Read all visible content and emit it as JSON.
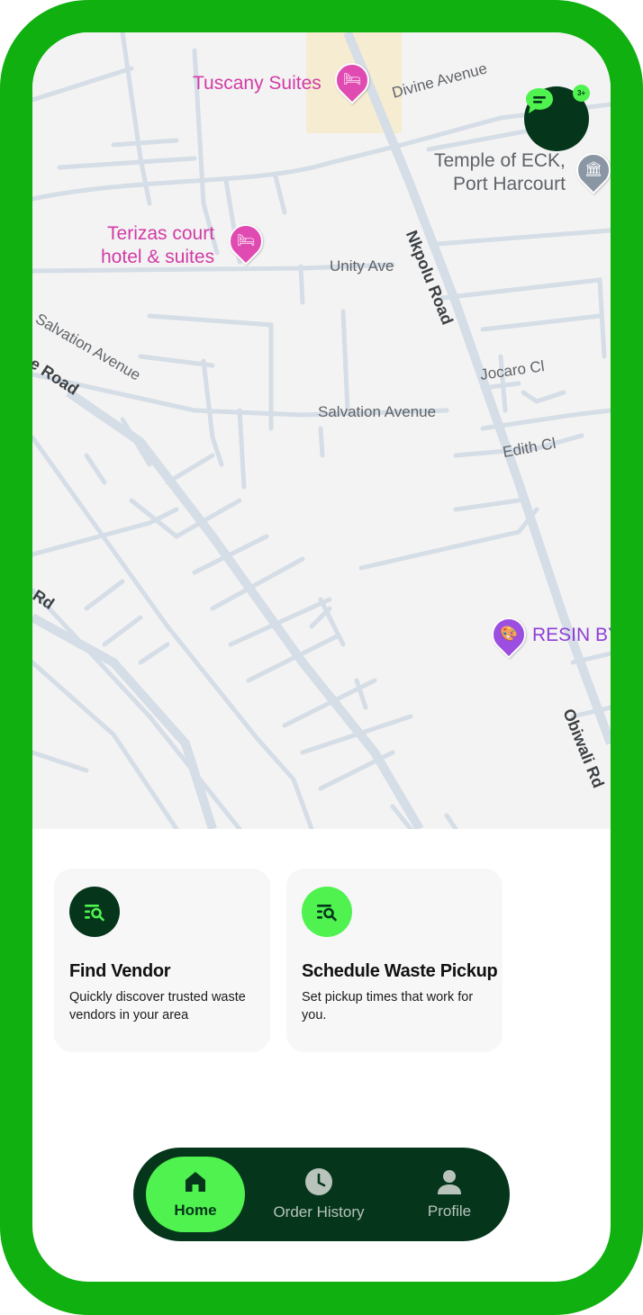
{
  "map": {
    "poi": {
      "tuscany": "Tuscany Suites",
      "terizas_line1": "Terizas court",
      "terizas_line2": "hotel & suites",
      "temple_line1": "Temple of ECK,",
      "temple_line2": "Port Harcourt",
      "resin": "RESIN BY"
    },
    "streets": {
      "divine": "Divine Avenue",
      "unity": "Unity Ave",
      "nkpolu": "Nkpolu Road",
      "salvation_diag": "Salvation Avenue",
      "salvation": "Salvation Avenue",
      "road_left": "e Road",
      "rd_left": "Rd",
      "jocaro": "Jocaro Cl",
      "edith": "Edith Cl",
      "obiwali": "Obiwali Rd"
    },
    "colors": {
      "map_bg": "#f3f3f3",
      "road": "#d5dde6",
      "hotel_pin": "#e04bb2",
      "worship_pin": "#8a96a3",
      "art_pin": "#9c4ee0"
    }
  },
  "chat": {
    "badge": "3+",
    "icon": "chat-bubble-icon"
  },
  "cards": [
    {
      "title": "Find Vendor",
      "desc": "Quickly discover trusted waste vendors in your area",
      "icon": "search-list-icon"
    },
    {
      "title": "Schedule Waste Pickup",
      "desc": "Set pickup times that work for you.",
      "icon": "search-list-icon"
    }
  ],
  "nav": {
    "home": "Home",
    "order_history": "Order History",
    "profile": "Profile",
    "active": "home"
  },
  "theme": {
    "frame": "#0fb00f",
    "dark": "#05361b",
    "accent": "#4ff24f"
  }
}
